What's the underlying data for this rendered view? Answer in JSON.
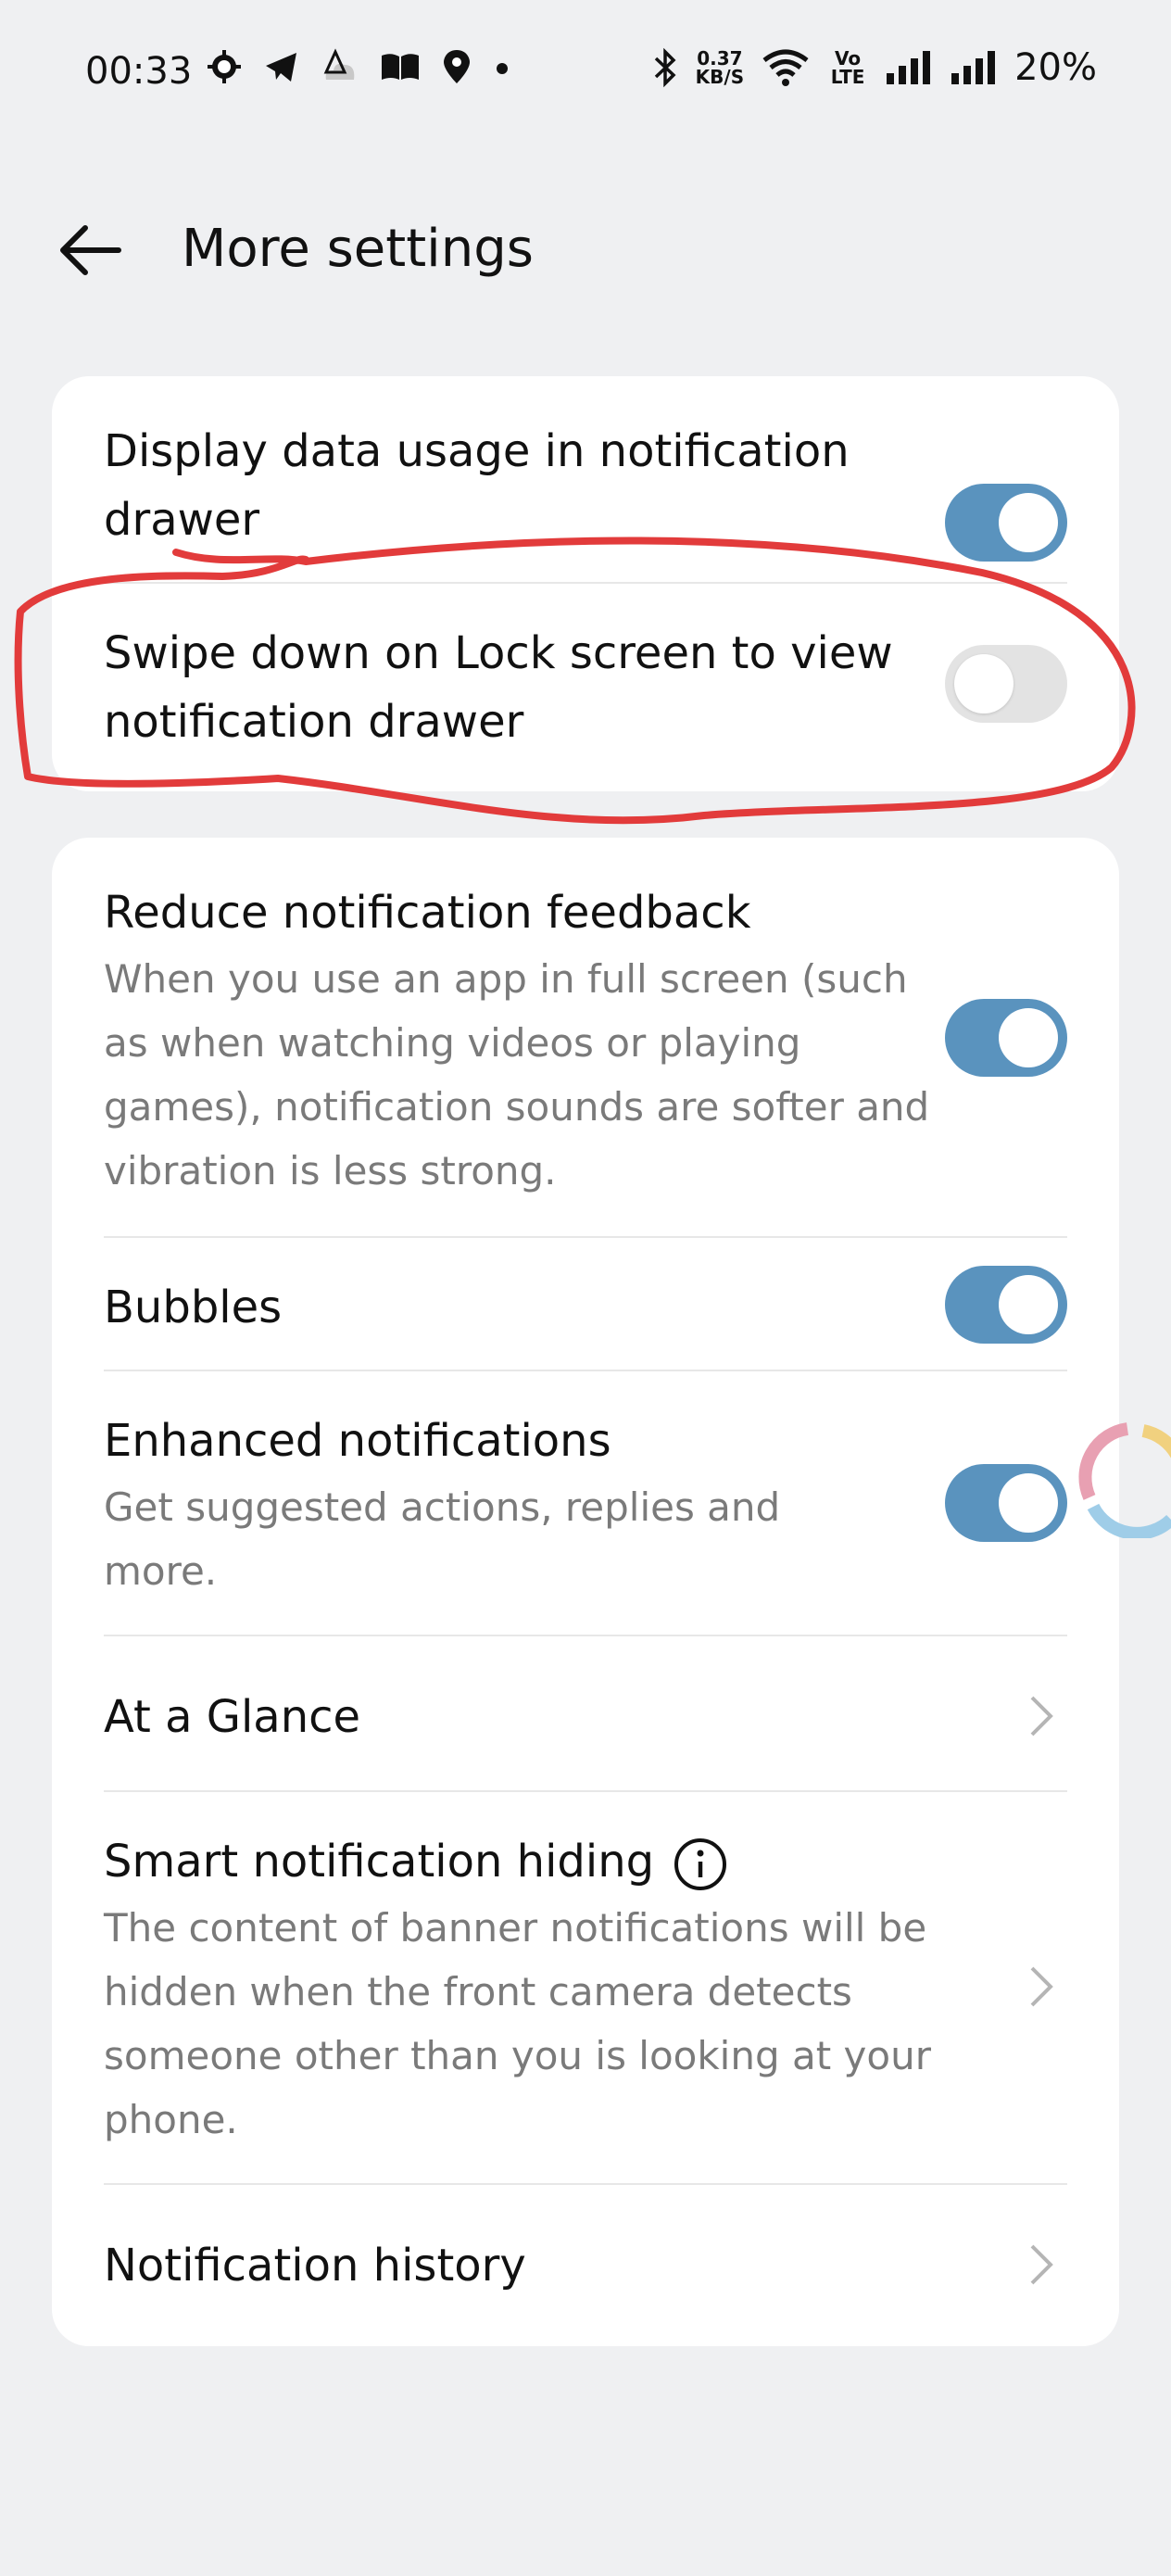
{
  "status_bar": {
    "time": "00:33",
    "speed_value": "0.37",
    "speed_unit": "KB/S",
    "network_label": "Vo LTE",
    "battery": "20%"
  },
  "header": {
    "title": "More settings"
  },
  "card1": {
    "rows": [
      {
        "title": "Display data usage in notification drawer",
        "enabled": true
      },
      {
        "title": "Swipe down on Lock screen to view notification drawer",
        "enabled": false
      }
    ]
  },
  "card2": {
    "rows": [
      {
        "title": "Reduce notification feedback",
        "desc": "When you use an app in full screen (such as when watching videos or playing games), notification sounds are softer and vibration is less strong.",
        "enabled": true
      },
      {
        "title": "Bubbles",
        "enabled": true
      },
      {
        "title": "Enhanced notifications",
        "desc": "Get suggested actions, replies and more.",
        "enabled": true
      },
      {
        "title": "At a Glance"
      },
      {
        "title": "Smart notification hiding",
        "desc": "The content of banner notifications will be hidden when the front camera detects someone other than you is looking at your phone."
      },
      {
        "title": "Notification history"
      }
    ]
  },
  "colors": {
    "toggle_on": "#5a93be",
    "toggle_off": "#e3e3e3",
    "annotation": "#e23b3b",
    "background": "#eff0f2"
  }
}
